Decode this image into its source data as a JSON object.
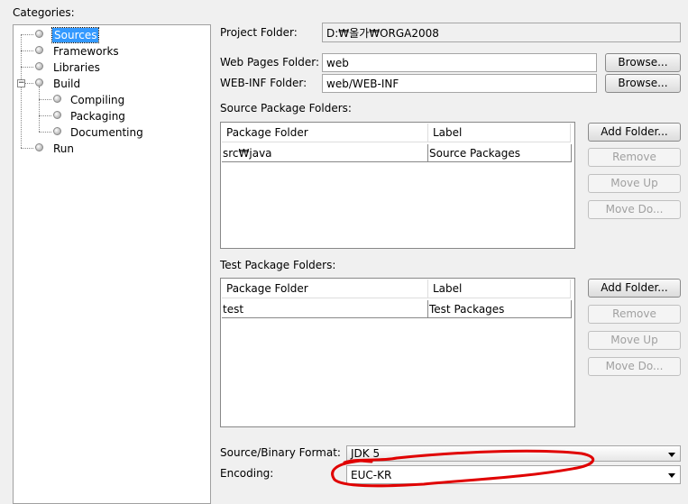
{
  "categories_label": "Categories:",
  "tree": [
    {
      "label": "Sources",
      "selected": true
    },
    {
      "label": "Frameworks"
    },
    {
      "label": "Libraries"
    },
    {
      "label": "Build",
      "expanded": true
    },
    {
      "label": "Compiling"
    },
    {
      "label": "Packaging"
    },
    {
      "label": "Documenting"
    },
    {
      "label": "Run"
    }
  ],
  "project_folder": {
    "label": "Project Folder:",
    "value": "D:₩올가₩ORGA2008"
  },
  "web_pages_folder": {
    "label": "Web Pages Folder:",
    "value": "web",
    "button": "Browse..."
  },
  "web_inf_folder": {
    "label": "WEB-INF Folder:",
    "value": "web/WEB-INF",
    "button": "Browse..."
  },
  "source_packages": {
    "label": "Source Package Folders:",
    "columns": [
      "Package Folder",
      "Label"
    ],
    "rows": [
      [
        "src₩java",
        "Source Packages"
      ]
    ],
    "buttons": [
      "Add Folder...",
      "Remove",
      "Move Up",
      "Move Do..."
    ]
  },
  "test_packages": {
    "label": "Test Package Folders:",
    "columns": [
      "Package Folder",
      "Label"
    ],
    "rows": [
      [
        "test",
        "Test Packages"
      ]
    ],
    "buttons": [
      "Add Folder...",
      "Remove",
      "Move Up",
      "Move Do..."
    ]
  },
  "source_binary_format": {
    "label": "Source/Binary Format:",
    "value": "JDK 5"
  },
  "encoding": {
    "label": "Encoding:",
    "value": "EUC-KR"
  },
  "colors": {
    "selection": "#3399ff",
    "annotation": "#e00000"
  }
}
